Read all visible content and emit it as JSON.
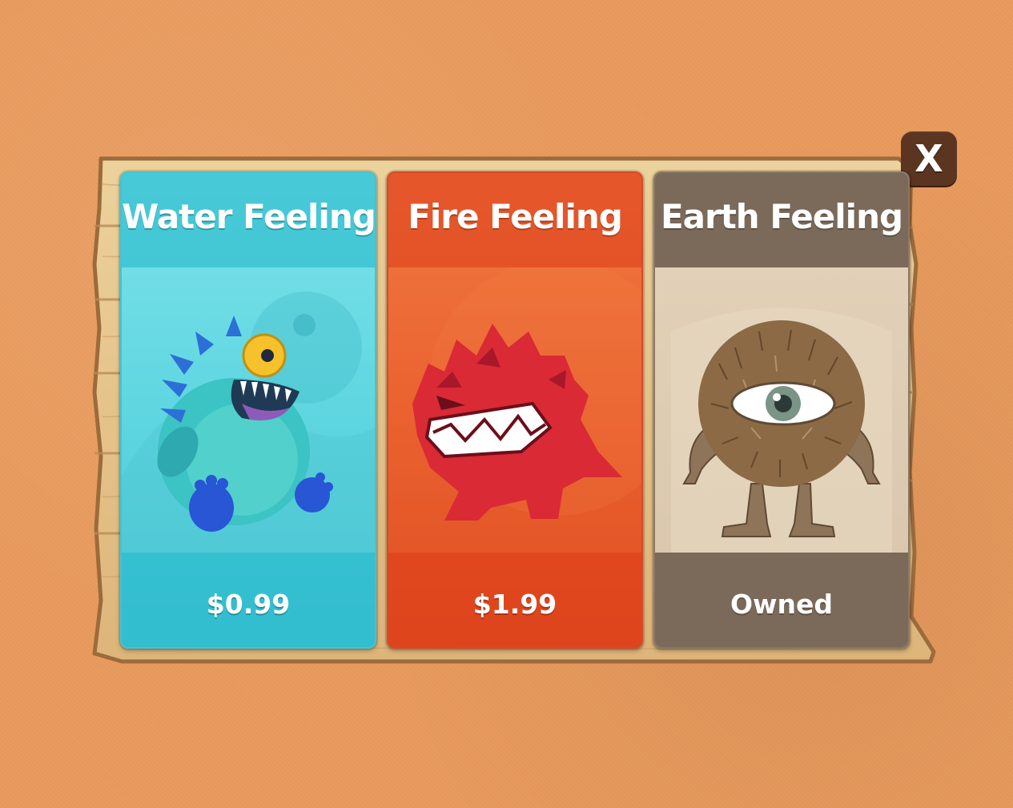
{
  "dialog": {
    "close_label": "X"
  },
  "cards": [
    {
      "title": "Water Feeling",
      "price": "$0.99",
      "monster": "water-monster",
      "color": "#5fd6e0"
    },
    {
      "title": "Fire Feeling",
      "price": "$1.99",
      "monster": "fire-monster",
      "color": "#ea6230"
    },
    {
      "title": "Earth Feeling",
      "price": "Owned",
      "monster": "earth-monster",
      "color": "#7b6a5a"
    }
  ],
  "colors": {
    "background": "#e99a5c",
    "board": "#e4c48e",
    "close_button": "#5b3520"
  }
}
